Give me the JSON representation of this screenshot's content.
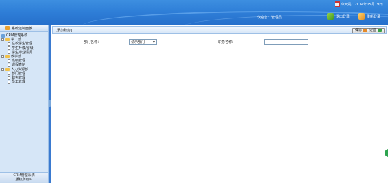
{
  "header": {
    "date_text": "今天是：2014年05月19日",
    "welcome_label": "欢迎您：",
    "username": "管理员",
    "logout_label": "退出登录",
    "relogin_label": "重新登录"
  },
  "sidebar": {
    "title": "系统控制面板",
    "tree": {
      "root": "CRM管理系统",
      "groups": [
        {
          "label": "学工部",
          "items": [
            "在校学生管理",
            "学生升级/留级",
            "学生毕业情况"
          ]
        },
        {
          "label": "教学部",
          "items": [
            "班级管理",
            "课程表制"
          ]
        },
        {
          "label": "人力资源部",
          "items": [
            "部门管理",
            "职务管理",
            "员工管理"
          ]
        }
      ]
    },
    "footer_line1": "CRM管理系统",
    "footer_line2": "版权所有©"
  },
  "main": {
    "breadcrumb": "[添加职务]",
    "save_label": "保存",
    "back_label": "返回",
    "form": {
      "dept_label": "部门名称：",
      "dept_selected": "请示部门",
      "job_label": "职务名称：",
      "job_value": ""
    }
  },
  "colors": {
    "header_blue": "#2f7fd8",
    "sidebar_bg": "#d6e6f7",
    "border_blue": "#9ec0e6"
  }
}
